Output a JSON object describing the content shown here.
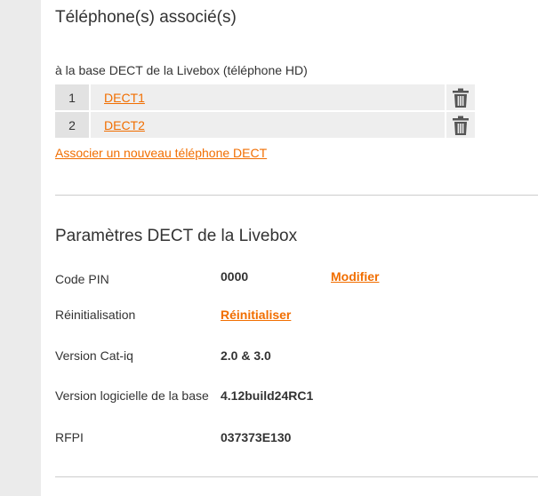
{
  "associated_phones": {
    "title": "Téléphone(s) associé(s)",
    "base_label": "à la base DECT de la Livebox (téléphone HD)",
    "phones": [
      {
        "index": "1",
        "name": "DECT1",
        "delete_icon": "trash-icon"
      },
      {
        "index": "2",
        "name": "DECT2",
        "delete_icon": "trash-icon"
      }
    ],
    "associate_link": "Associer un nouveau téléphone DECT"
  },
  "dect_params": {
    "title": "Paramètres DECT de la Livebox",
    "pin": {
      "label": "Code PIN",
      "value": "0000",
      "action": "Modifier"
    },
    "reset": {
      "label": "Réinitialisation",
      "action": "Réinitialiser"
    },
    "catiq": {
      "label": "Version Cat-iq",
      "value": "2.0 & 3.0"
    },
    "software": {
      "label": "Version logicielle de la base",
      "value": "4.12build24RC1"
    },
    "rfpi": {
      "label": "RFPI",
      "value": "037373E130"
    }
  },
  "colors": {
    "accent": "#f16e00",
    "sidebar": "#ebebeb",
    "row_number_bg": "#e2e2e2",
    "row_bg": "#eeeeee",
    "icon": "#555555"
  }
}
